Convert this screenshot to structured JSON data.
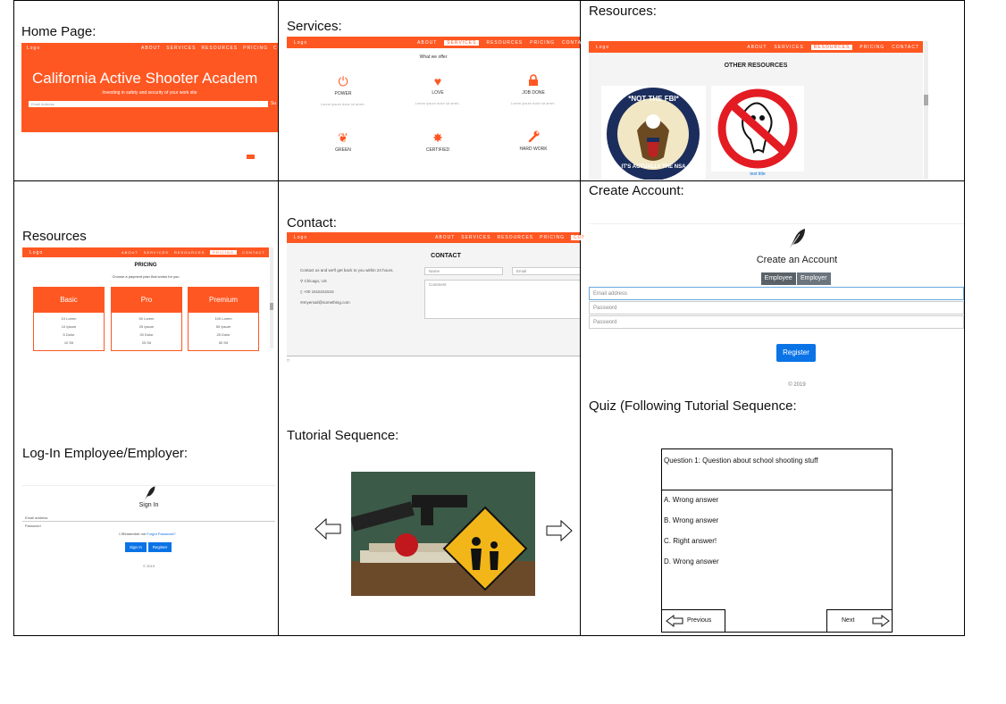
{
  "captions": {
    "home": "Home Page:",
    "services": "Services:",
    "resources1": "Resources:",
    "resources2": "Resources",
    "contact": "Contact:",
    "create_account": "Create Account:",
    "login": "Log-In Employee/Employer:",
    "tutorial": "Tutorial Sequence:",
    "quiz": "Quiz (Following Tutorial Sequence:"
  },
  "nav": {
    "logo": "Logo",
    "items": [
      "ABOUT",
      "SERVICES",
      "RESOURCES",
      "PRICING",
      "CONTACT"
    ]
  },
  "home": {
    "title": "California Active Shooter Academ",
    "subtitle": "Investing in safety and security of your work site",
    "email_placeholder": "Email Address",
    "submit_partial": "Su"
  },
  "services": {
    "heading": "What we offer",
    "items": [
      {
        "icon": "power-icon",
        "glyph": "⏻",
        "label": "POWER"
      },
      {
        "icon": "heart-icon",
        "glyph": "♥",
        "label": "LOVE"
      },
      {
        "icon": "lock-icon",
        "glyph": "🔒",
        "label": "JOB DONE"
      },
      {
        "icon": "leaf-icon",
        "glyph": "❦",
        "label": "GREEN"
      },
      {
        "icon": "certificate-icon",
        "glyph": "✸",
        "label": "CERTIFIED"
      },
      {
        "icon": "wrench-icon",
        "glyph": "🔧",
        "label": "HARD WORK"
      }
    ],
    "lorem": "Lorem ipsum dolor sit amet.."
  },
  "resources": {
    "heading": "OTHER RESOURCES",
    "seal_top": "*NOT THE FBI*",
    "seal_bottom": "IT'S ACTUALLY THE NSA",
    "caption": "test title"
  },
  "pricing": {
    "heading": "PRICING",
    "subheading": "Choose a payment plan that works for you",
    "plans": [
      {
        "name": "Basic",
        "rows": [
          "10 Lorem",
          "10 Ipsum",
          "5 Dolor",
          "10 Sit",
          "Endless Amet"
        ]
      },
      {
        "name": "Pro",
        "rows": [
          "50 Lorem",
          "25 Ipsum",
          "20 Dolor",
          "25 Sit",
          "Endless Amet"
        ]
      },
      {
        "name": "Premium",
        "rows": [
          "100 Lorem",
          "50 Ipsum",
          "25 Dolor",
          "50 Sit",
          "Endless Amet"
        ]
      }
    ]
  },
  "contact": {
    "heading": "CONTACT",
    "intro": "Contact us and we'll get back to you within 24 hours.",
    "location": "Chicago, US",
    "phone": "+00 1515151515",
    "email": "myemail@something.com",
    "name_placeholder": "Name",
    "email_placeholder": "Email",
    "comment_placeholder": "Comment"
  },
  "create": {
    "title": "Create an Account",
    "toggle": [
      "Employee",
      "Employer"
    ],
    "email_placeholder": "Email address",
    "password_placeholder": "Password",
    "confirm_placeholder": "Password",
    "register": "Register",
    "footer": "© 2019"
  },
  "login": {
    "title": "Sign In",
    "email_label": "Email address",
    "password_label": "Password",
    "remember": "Remember me",
    "forgot": "Forgot Password?",
    "signin": "Sign In",
    "register": "Register",
    "footer": "© 2019"
  },
  "quiz": {
    "question": "Question 1: Question about school shooting stuff",
    "answers": [
      "A. Wrong answer",
      "B. Wrong answer",
      "C. Right answer!",
      "D. Wrong answer"
    ],
    "previous": "Previous",
    "next": "Next"
  },
  "colors": {
    "accent": "#ff5722",
    "blue": "#0a73e6"
  }
}
